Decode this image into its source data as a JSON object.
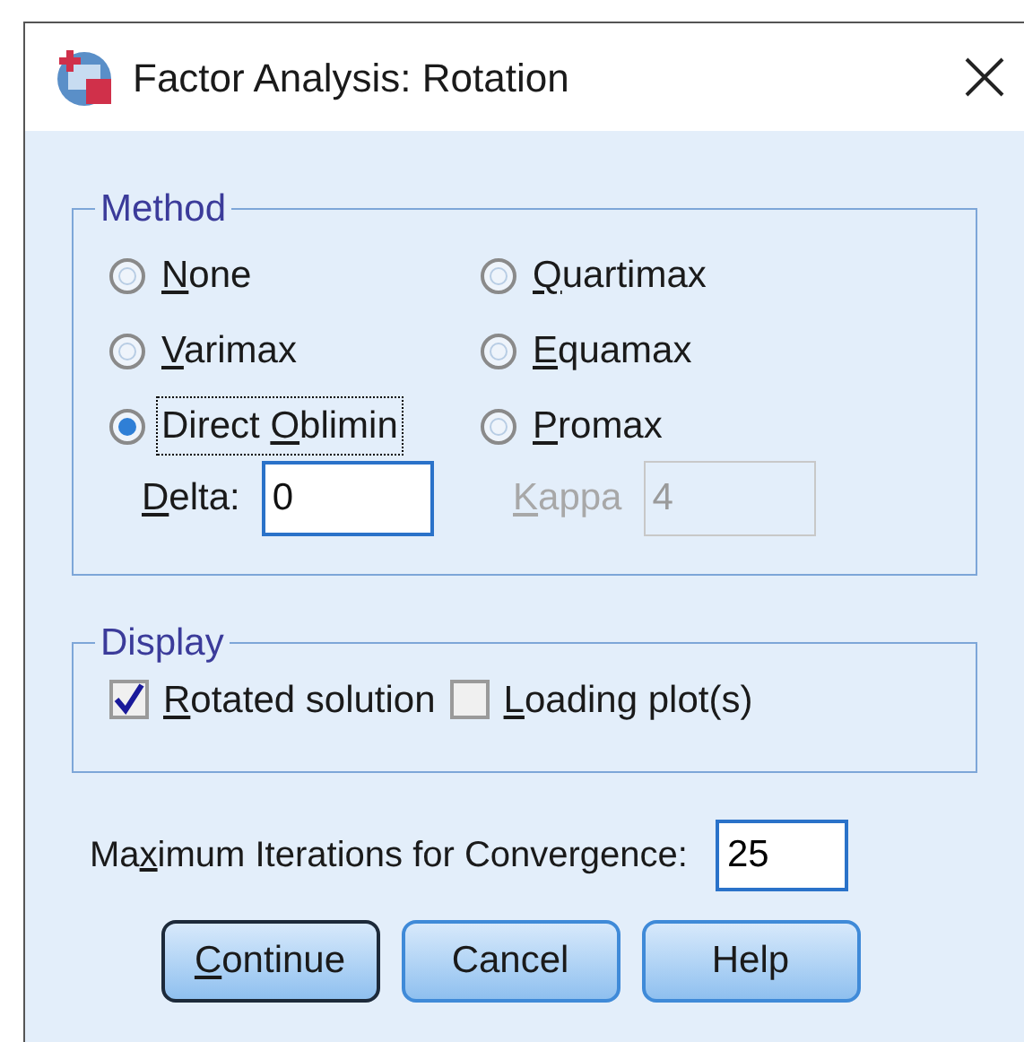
{
  "window": {
    "title": "Factor Analysis: Rotation"
  },
  "method": {
    "title": "Method",
    "options": [
      {
        "label": {
          "key": "N",
          "after": "one"
        },
        "selected": false,
        "focused": false
      },
      {
        "label": {
          "key": "Q",
          "after": "uartimax"
        },
        "selected": false,
        "focused": false
      },
      {
        "label": {
          "key": "V",
          "after": "arimax"
        },
        "selected": false,
        "focused": false
      },
      {
        "label": {
          "key": "E",
          "after": "quamax"
        },
        "selected": false,
        "focused": false
      },
      {
        "label": {
          "before": "Direct ",
          "key": "O",
          "after": "blimin"
        },
        "selected": true,
        "focused": true
      },
      {
        "label": {
          "key": "P",
          "after": "romax"
        },
        "selected": false,
        "focused": false
      }
    ],
    "params": [
      {
        "label": {
          "key": "D",
          "after": "elta:"
        },
        "value": "0",
        "disabled": false,
        "focused": true
      },
      {
        "label": {
          "key": "K",
          "after": "appa"
        },
        "value": "4",
        "disabled": true
      }
    ]
  },
  "display": {
    "title": "Display",
    "options": [
      {
        "label": {
          "key": "R",
          "after": "otated solution"
        },
        "checked": true
      },
      {
        "label": {
          "key": "L",
          "after": "oading plot(s)"
        },
        "checked": false
      }
    ]
  },
  "iterations": {
    "label": {
      "before": "Ma",
      "key": "x",
      "after": "imum Iterations for Convergence:"
    },
    "value": "25"
  },
  "buttons": [
    {
      "label": {
        "key": "C",
        "after": "ontinue"
      },
      "default": true
    },
    {
      "label": {
        "after": "Cancel"
      },
      "default": false
    },
    {
      "label": {
        "after": "Help"
      },
      "default": false
    }
  ]
}
